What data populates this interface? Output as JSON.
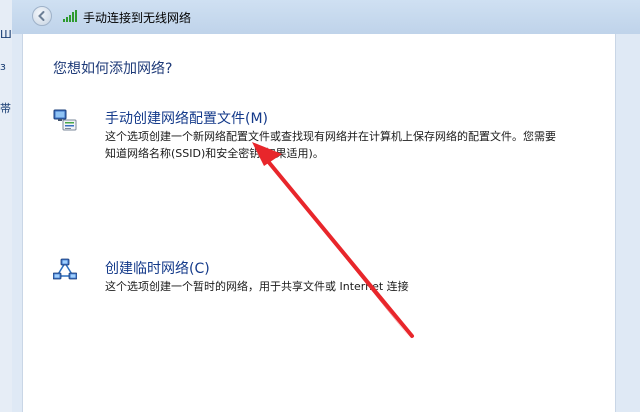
{
  "background_window": {
    "fragments": [
      "Ш",
      "з",
      "帯"
    ]
  },
  "window": {
    "title": "手动连接到无线网络"
  },
  "page": {
    "question": "您想如何添加网络?"
  },
  "options": [
    {
      "title": "手动创建网络配置文件(M)",
      "description": "这个选项创建一个新网络配置文件或查找现有网络并在计算机上保存网络的配置文件。您需要知道网络名称(SSID)和安全密钥(如果适用)。",
      "icon": "network-profile-icon"
    },
    {
      "title": "创建临时网络(C)",
      "description": "这个选项创建一个暂时的网络，用于共享文件或 Internet 连接",
      "icon": "adhoc-network-icon"
    }
  ],
  "colors": {
    "link_blue": "#143a8a",
    "heading_blue": "#1e3a78",
    "annotation_red": "#e8262b"
  }
}
